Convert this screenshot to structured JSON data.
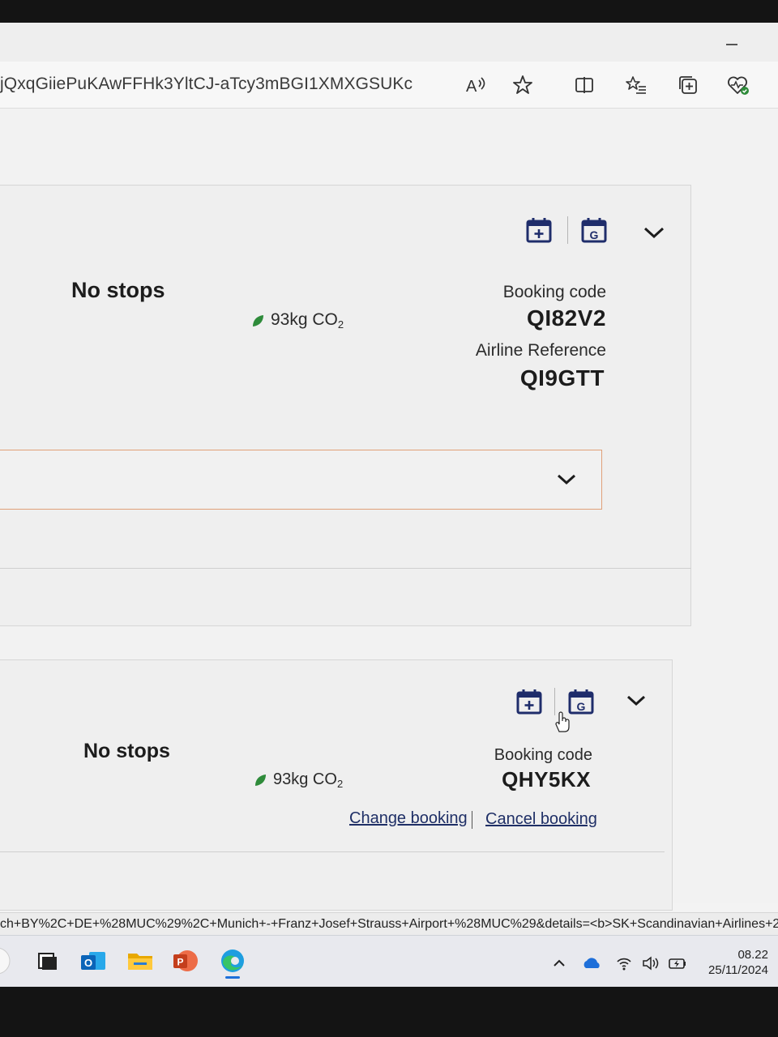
{
  "browser": {
    "url": "jQxqGiiePuKAwFFHk3YltCJ-aTcy3mBGI1XMXGSUKc",
    "toolbar_icons": [
      "read-aloud-icon",
      "favorite-star-icon",
      "split-screen-icon",
      "favorites-list-icon",
      "collections-icon",
      "browser-essentials-icon"
    ]
  },
  "bookings": [
    {
      "stops": "No stops",
      "co2_value": "93kg CO",
      "co2_sub": "2",
      "booking_code_label": "Booking code",
      "booking_code": "QI82V2",
      "airline_ref_label": "Airline Reference",
      "airline_ref": "QI9GTT"
    },
    {
      "stops": "No stops",
      "co2_value": "93kg CO",
      "co2_sub": "2",
      "booking_code_label": "Booking code",
      "booking_code": "QHY5KX",
      "change_booking": "Change booking",
      "cancel_booking": "Cancel booking"
    }
  ],
  "status_url": "ch+BY%2C+DE+%28MUC%29%2C+Munich+-+Franz+Josef+Strauss+Airport+%28MUC%29&details=<b>SK+Scandinavian+Airlines+2...",
  "taskbar": {
    "apps": [
      "task-view-icon",
      "outlook-icon",
      "file-explorer-icon",
      "powerpoint-icon",
      "edge-icon"
    ],
    "time": "08.22",
    "date": "25/11/2024"
  },
  "colors": {
    "leaf_green": "#2e8b3a",
    "calendar_navy": "#1f2d6b",
    "accent_border": "#e0a078",
    "link_blue": "#1f2f66"
  }
}
